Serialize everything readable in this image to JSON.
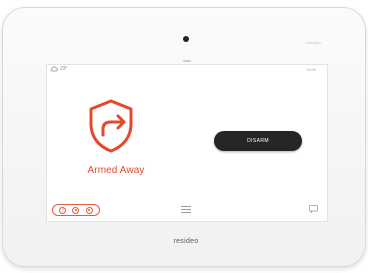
{
  "device": {
    "brand": "resideo",
    "top_right_mark": "resideo"
  },
  "screen": {
    "status_left": {
      "icon": "cloud-icon",
      "text": "23°"
    },
    "status_right": "10:00",
    "system_state": {
      "label": "Armed Away",
      "icon": "shield-arrow-icon",
      "color": "#e8472d"
    },
    "disarm_button": {
      "label": "DISARM"
    },
    "bottom_bar": {
      "pill_icons": [
        "emergency-icon",
        "home-icon",
        "away-icon"
      ],
      "menu_icon": "menu-icon",
      "chat_icon": "message-icon"
    }
  },
  "colors": {
    "accent": "#e8472d",
    "button_bg": "#262626"
  }
}
